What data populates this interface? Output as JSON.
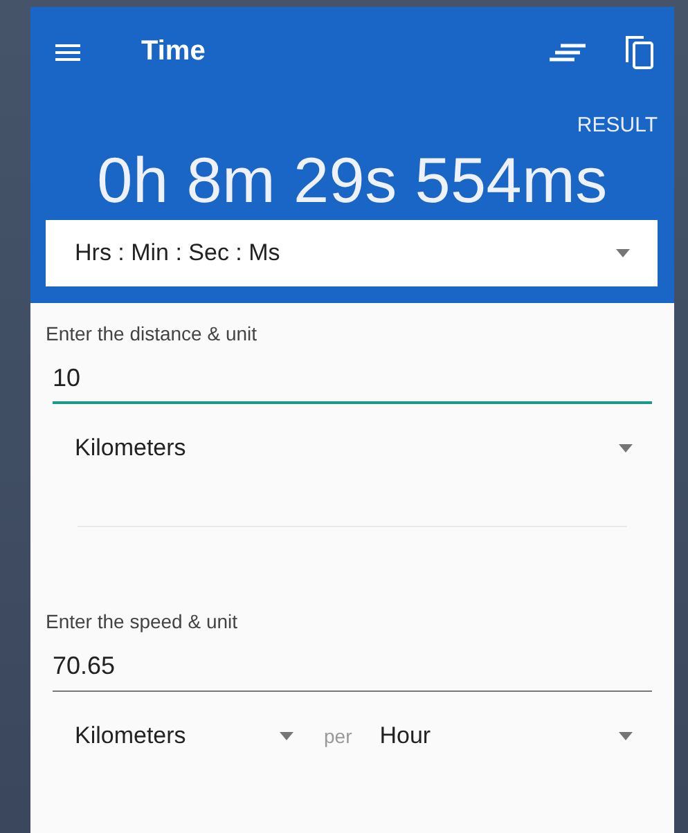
{
  "toolbar": {
    "title": "Time"
  },
  "result": {
    "caption": "RESULT",
    "value": "0h 8m 29s 554ms",
    "format": "Hrs : Min : Sec : Ms"
  },
  "sections": [
    {
      "label": "Enter the distance & unit",
      "value": "10",
      "focused": true,
      "units": [
        {
          "kind": "dropdown",
          "text": "Kilometers"
        }
      ]
    },
    {
      "label": "Enter the speed & unit",
      "value": "70.65",
      "focused": false,
      "units": [
        {
          "kind": "dropdown",
          "text": "Kilometers"
        },
        {
          "kind": "joiner",
          "text": "per"
        },
        {
          "kind": "dropdown",
          "text": "Hour"
        }
      ]
    }
  ]
}
